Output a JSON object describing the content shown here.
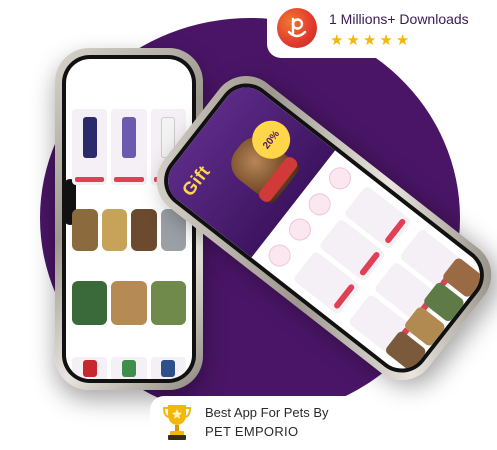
{
  "badge": {
    "downloads_text": "1 Millions+ Downloads",
    "stars": [
      "★",
      "★",
      "★",
      "★",
      "★"
    ],
    "logo_icon": "pet-emporio-logo-icon"
  },
  "award": {
    "line1": "Best App For Pets By",
    "line2": "PET EMPORIO",
    "icon": "trophy-icon"
  },
  "colors": {
    "brand_purple": "#4a1566",
    "accent_red": "#e04055",
    "star_gold": "#f2b707",
    "banner_yellow": "#ffd54a"
  },
  "right_phone": {
    "banner_text": "Gift",
    "banner_badge": "20%"
  }
}
